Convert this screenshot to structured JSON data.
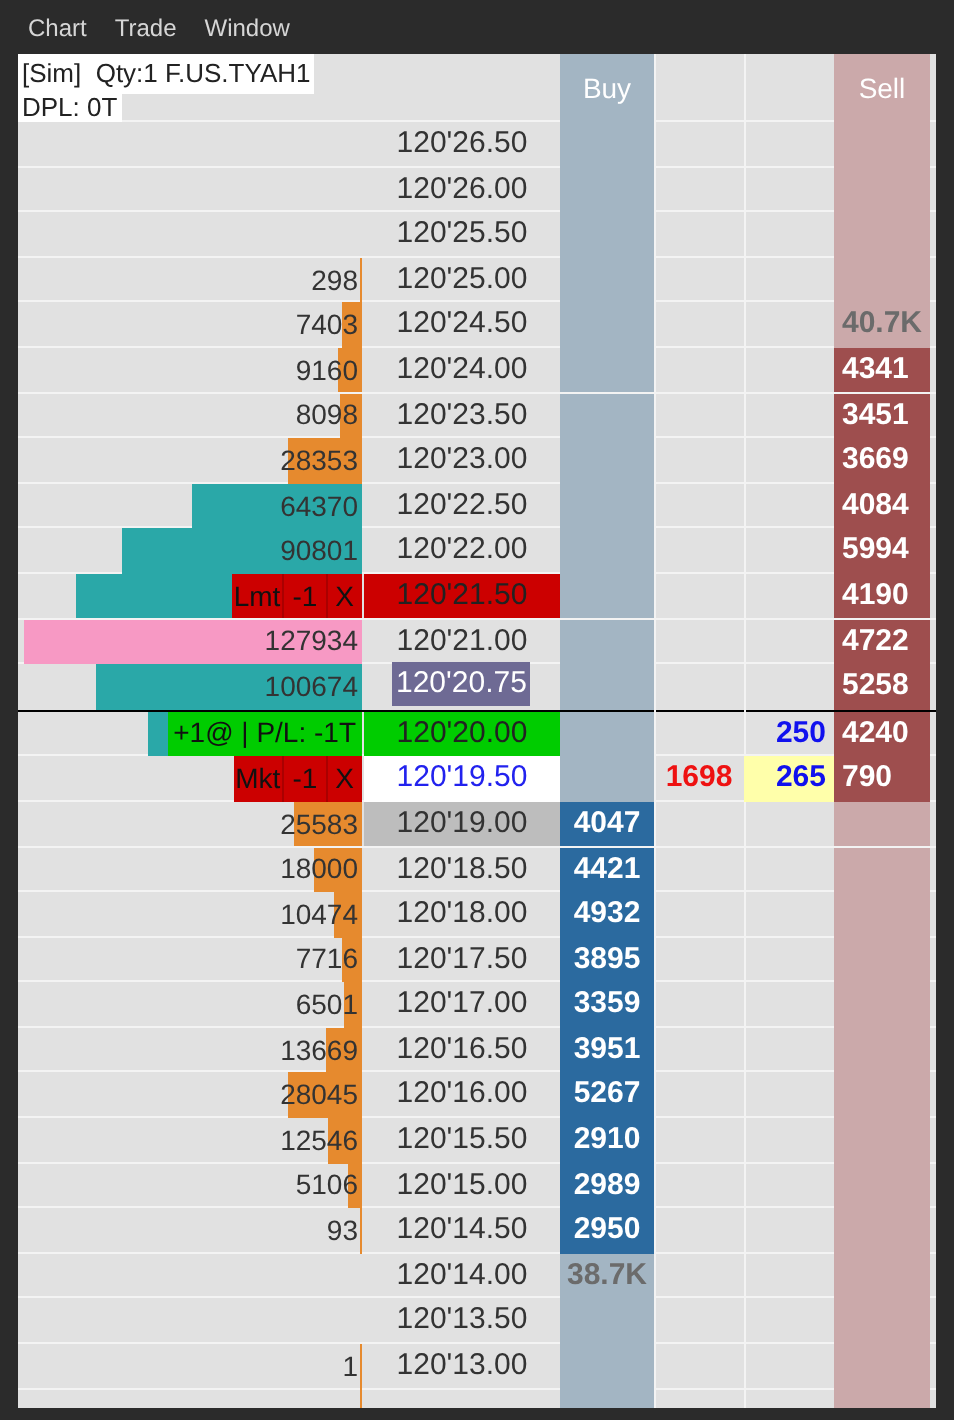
{
  "menu": [
    {
      "label": "Chart"
    },
    {
      "label": "Trade"
    },
    {
      "label": "Window"
    }
  ],
  "header": {
    "info": "[Sim]  Qty:1 F.US.TYAH1",
    "dpl": "DPL: 0T",
    "buy": "Buy",
    "sell": "Sell"
  },
  "rows": [
    {
      "kind": "plain",
      "price": "120'26.50"
    },
    {
      "kind": "plain",
      "price": "120'26.00"
    },
    {
      "kind": "plain",
      "price": "120'25.50"
    },
    {
      "kind": "plain",
      "price": "120'25.00",
      "volume": "298",
      "bar": {
        "color": "#e68a2e"
      }
    },
    {
      "kind": "plain",
      "price": "120'24.50",
      "volume": "7403",
      "bar": {
        "color": "#e68a2e"
      },
      "sell": {
        "text": "40.7K",
        "kind": "total"
      }
    },
    {
      "kind": "plain",
      "price": "120'24.00",
      "volume": "9160",
      "bar": {
        "color": "#e68a2e"
      },
      "sell": {
        "text": "4341",
        "kind": "size"
      }
    },
    {
      "kind": "plain",
      "price": "120'23.50",
      "volume": "8098",
      "bar": {
        "color": "#e68a2e"
      },
      "sell": {
        "text": "3451",
        "kind": "size"
      }
    },
    {
      "kind": "plain",
      "price": "120'23.00",
      "volume": "28353",
      "bar": {
        "color": "#e68a2e"
      },
      "sell": {
        "text": "3669",
        "kind": "size"
      }
    },
    {
      "kind": "plain",
      "price": "120'22.50",
      "volume": "64370",
      "bar": {
        "color": "#2aa8a8"
      },
      "sell": {
        "text": "4084",
        "kind": "size"
      }
    },
    {
      "kind": "plain",
      "price": "120'22.00",
      "volume": "90801",
      "bar": {
        "color": "#2aa8a8"
      },
      "sell": {
        "text": "5994",
        "kind": "size"
      }
    },
    {
      "kind": "order",
      "price": "120'21.50",
      "bar": {
        "color": "#2aa8a8"
      },
      "order": {
        "kind": "limit",
        "type": "Lmt",
        "qty": "-1",
        "cancel": "X"
      },
      "sell": {
        "text": "4190",
        "kind": "size"
      }
    },
    {
      "kind": "plain",
      "price": "120'21.00",
      "volume": "127934",
      "bar": {
        "color": "#f799c4"
      },
      "sell": {
        "text": "4722",
        "kind": "size"
      }
    },
    {
      "last_price": "120'20.75",
      "separator": true,
      "volume": "100674",
      "bar": {
        "color": "#2aa8a8"
      },
      "sell": {
        "text": "5258",
        "kind": "size"
      }
    },
    {
      "kind": "position",
      "price": "120'20.00",
      "bar": {
        "color": "#2aa8a8"
      },
      "order": {
        "kind": "position",
        "text": "+1@ | P/L: -1T"
      },
      "col5": {
        "text": "250",
        "highlighted": false
      },
      "sell": {
        "text": "4240",
        "kind": "size"
      }
    },
    {
      "kind": "current",
      "price": "120'19.50",
      "order": {
        "kind": "market",
        "type": "Mkt",
        "qty": "-1",
        "cancel": "X"
      },
      "col4": "1698",
      "col5": {
        "text": "265",
        "highlighted": true
      },
      "sell": {
        "text": "790",
        "kind": "size"
      }
    },
    {
      "kind": "marked",
      "price": "120'19.00",
      "volume": "25583",
      "bar": {
        "color": "#e68a2e"
      },
      "buy": {
        "text": "4047",
        "kind": "size"
      }
    },
    {
      "kind": "plain",
      "price": "120'18.50",
      "volume": "18000",
      "bar": {
        "color": "#e68a2e"
      },
      "buy": {
        "text": "4421",
        "kind": "size"
      }
    },
    {
      "kind": "plain",
      "price": "120'18.00",
      "volume": "10474",
      "bar": {
        "color": "#e68a2e"
      },
      "buy": {
        "text": "4932",
        "kind": "size"
      }
    },
    {
      "kind": "plain",
      "price": "120'17.50",
      "volume": "7716",
      "bar": {
        "color": "#e68a2e"
      },
      "buy": {
        "text": "3895",
        "kind": "size"
      }
    },
    {
      "kind": "plain",
      "price": "120'17.00",
      "volume": "6501",
      "bar": {
        "color": "#e68a2e"
      },
      "buy": {
        "text": "3359",
        "kind": "size"
      }
    },
    {
      "kind": "plain",
      "price": "120'16.50",
      "volume": "13669",
      "bar": {
        "color": "#e68a2e"
      },
      "buy": {
        "text": "3951",
        "kind": "size"
      }
    },
    {
      "kind": "plain",
      "price": "120'16.00",
      "volume": "28045",
      "bar": {
        "color": "#e68a2e"
      },
      "buy": {
        "text": "5267",
        "kind": "size"
      }
    },
    {
      "kind": "plain",
      "price": "120'15.50",
      "volume": "12546",
      "bar": {
        "color": "#e68a2e"
      },
      "buy": {
        "text": "2910",
        "kind": "size"
      }
    },
    {
      "kind": "plain",
      "price": "120'15.00",
      "volume": "5106",
      "bar": {
        "color": "#e68a2e"
      },
      "buy": {
        "text": "2989",
        "kind": "size"
      }
    },
    {
      "kind": "plain",
      "price": "120'14.50",
      "volume": "93",
      "bar": {
        "color": "#e68a2e"
      },
      "buy": {
        "text": "2950",
        "kind": "size"
      }
    },
    {
      "kind": "plain",
      "price": "120'14.00",
      "buy": {
        "text": "38.7K",
        "kind": "total"
      }
    },
    {
      "kind": "plain",
      "price": "120'13.50"
    },
    {
      "kind": "plain",
      "price": "120'13.00",
      "volume": "1",
      "bar": {
        "color": "#e68a2e"
      }
    },
    {
      "bar": {
        "color": "#e68a2e"
      }
    }
  ]
}
